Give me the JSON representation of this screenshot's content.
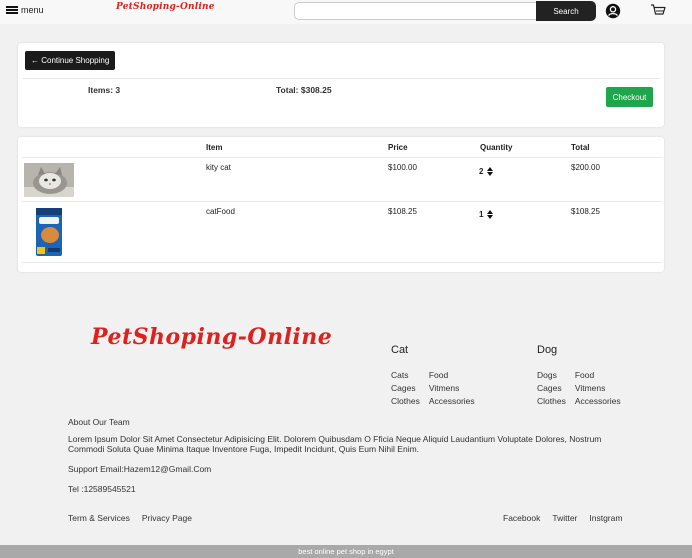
{
  "nav": {
    "menu_label": "menu",
    "brand": "PetShoping-Online",
    "search_placeholder": "",
    "search_label": "Search"
  },
  "summary": {
    "continue_label": "← Continue Shopping",
    "items_label": "Items: 3",
    "total_label": "Total: $308.25",
    "checkout_label": "Checkout"
  },
  "cart": {
    "headers": {
      "item": "Item",
      "price": "Price",
      "quantity": "Quantity",
      "total": "Total"
    },
    "rows": [
      {
        "name": "kity cat",
        "price": "$100.00",
        "quantity": "2",
        "total": "$200.00"
      },
      {
        "name": "catFood",
        "price": "$108.25",
        "quantity": "1",
        "total": "$108.25"
      }
    ]
  },
  "footer": {
    "brand": "PetShoping-Online",
    "cat": {
      "title": "Cat",
      "links": [
        "Cats",
        "Food",
        "Cages",
        "Vitmens",
        "Clothes",
        "Accessories"
      ]
    },
    "dog": {
      "title": "Dog",
      "links": [
        "Dogs",
        "Food",
        "Cages",
        "Vitmens",
        "Clothes",
        "Accessories"
      ]
    },
    "about": "About Our Team",
    "lorem": "Lorem Ipsum Dolor Sit Amet Consectetur Adipisicing Elit. Dolorem Quibusdam O Fficia Neque Aliquid Laudantium Voluptate Dolores, Nostrum Commodi Soluta Quae Minima Itaque Inventore Fuga, Impedit Incidunt, Quis Eum Nihil Enim.",
    "support": "Support Email:Hazem12@Gmail.Com",
    "tel": "Tel :12589545521",
    "terms": "Term & Services",
    "privacy": "Privacy Page",
    "facebook": "Facebook",
    "twitter": "Twitter",
    "instagram": "Instgram",
    "tagline": "best online pet shop in egypt"
  },
  "colors": {
    "brand_red": "#e0201c",
    "checkout_green": "#1fa54b",
    "dark": "#1b1b1b"
  },
  "icons": [
    "menu-icon",
    "user-icon",
    "cart-icon",
    "up-down-arrow-icon"
  ]
}
